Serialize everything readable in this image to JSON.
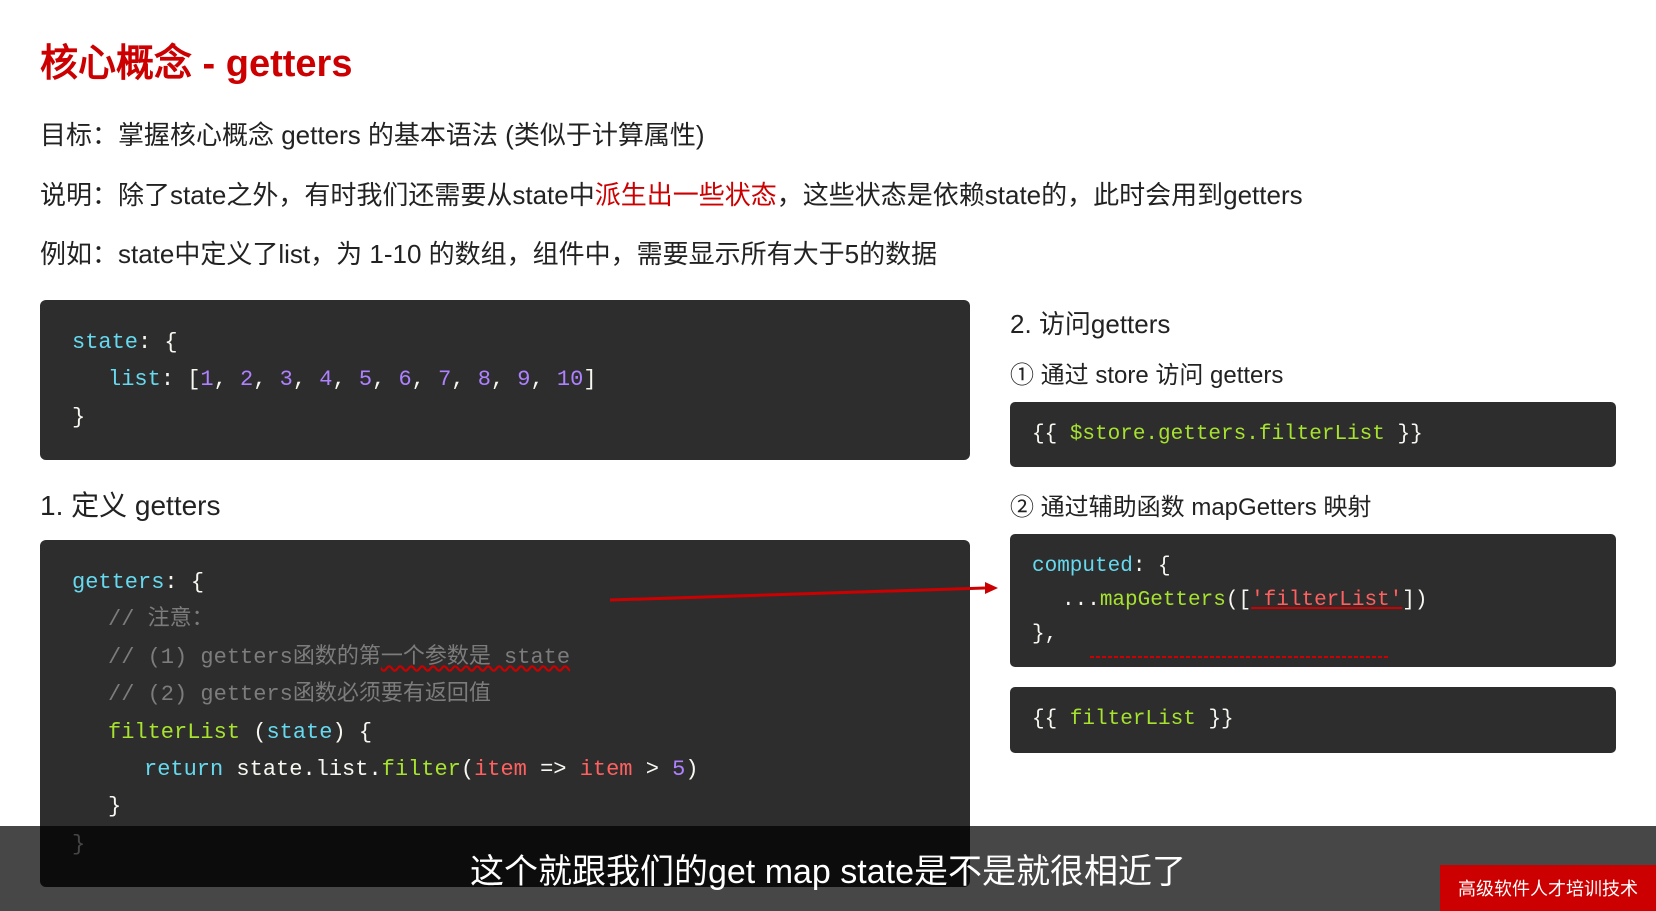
{
  "page": {
    "title": "核心概念 - getters",
    "descriptions": [
      "目标：掌握核心概念 getters 的基本语法 (类似于计算属性)",
      "说明：除了state之外，有时我们还需要从state中",
      "派生出一些状态",
      "，这些状态是依赖state的，此时会用到getters",
      "例如：state中定义了list，为 1-10 的数组，组件中，需要显示所有大于5的数据"
    ],
    "state_code": {
      "line1": "state: {",
      "line2": "    list: [1, 2, 3, 4, 5, 6, 7, 8, 9, 10]",
      "line3": "}"
    },
    "section1_title": "1. 定义 getters",
    "getters_code": {
      "line1": "getters: {",
      "line2": "  // 注意：",
      "line3": "  // (1) getters函数的第一个参数是 state",
      "line4": "  // (2) getters函数必须要有返回值",
      "line5": "  filterList (state) {",
      "line6": "    return state.list.filter(item => item > 5)",
      "line7": "  }",
      "line8": "}"
    },
    "section2_title": "2. 访问getters",
    "access1_title": "① 通过 store 访问 getters",
    "access1_code": "{{ $store.getters.filterList }}",
    "access2_title": "② 通过辅助函数 mapGetters 映射",
    "computed_code": {
      "line1": "computed: {",
      "line2": "  ...mapGetters(['filterList'])",
      "line3": "},"
    },
    "filter_code": "{{ filterList }}",
    "subtitle": "这个就跟我们的get map state是不是就很相近了",
    "watermark": "高级软件人才培训技术"
  }
}
